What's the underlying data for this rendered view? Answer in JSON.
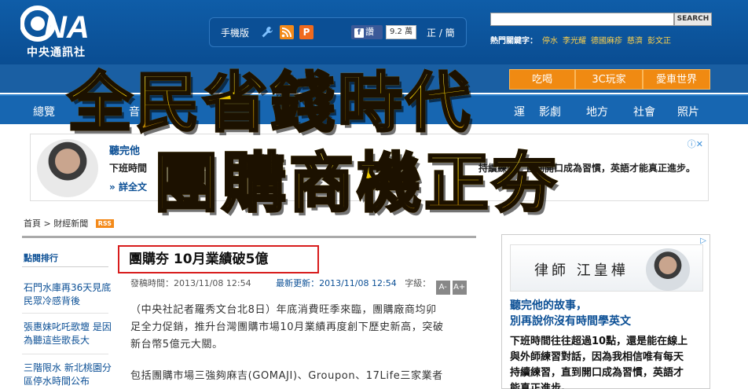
{
  "header": {
    "logo_text": "中央通訊社",
    "mobile_label": "手機版",
    "fb_like_label": "讚",
    "fb_like_count": "9.2 萬",
    "lang_switch": "正 / 簡",
    "search": {
      "button_label": "SEARCH",
      "placeholder": ""
    },
    "hot_keywords_label": "熱門關鍵字：",
    "hot_keywords": [
      "停水",
      "李光耀",
      "德國麻疹",
      "慈濟",
      "彭文正"
    ]
  },
  "channels": [
    "吃喝",
    "3C玩家",
    "愛車世界"
  ],
  "nav": [
    "總覽",
    "",
    "影劇",
    "地方",
    "社會",
    "照片"
  ],
  "nav_partial": {
    "left": "音",
    "right": "運"
  },
  "ad_top": {
    "title": "聽完他",
    "line": "下班時間",
    "line_right": "持續練習，直到開口成為習慣，英語才能真正進步。",
    "more": "詳全文",
    "info_icon": "info-icon"
  },
  "breadcrumb": {
    "home": "首頁",
    "section": "財經新聞",
    "rss": "RSS",
    "separator": ">"
  },
  "ranking": {
    "heading": "點閱排行",
    "items": [
      "石門水庫再36天見底 民眾冷感背後",
      "張惠妹叱吒歌壇 是因為聽這些歌長大",
      "三階限水 新北桃園分區停水時間公布"
    ]
  },
  "article": {
    "headline": "團購夯 10月業績破5億",
    "publish_label": "發稿時間：",
    "publish_time": "2013/11/08 12:54",
    "update_label": "最新更新：",
    "update_time": "2013/11/08 12:54",
    "font_label": "字級：",
    "font_smaller": "A-",
    "font_larger": "A+",
    "paragraphs": [
      "（中央社記者羅秀文台北8日）年底消費旺季來臨，團購廠商均卯",
      "足全力促銷，推升台灣團購市場10月業績再度創下歷史新高，突破",
      "新台幣5億元大關。",
      "包括團購市場三強夠麻吉(GOMAJI)、Groupon、17Life三家業者"
    ]
  },
  "ad_right": {
    "image_text": "律師 江皇樺",
    "title_line1": "聽完他的故事，",
    "title_line2": "別再說你沒有時間學英文",
    "body_line1": "下班時間往往超過10點，還是能在線上",
    "body_line2": "與外師練習對話，因為我相信唯有每天",
    "body_line3": "持續練習，直到開口成為習慣，英語才",
    "body_line4": "能真正進步。"
  },
  "overlay": {
    "line1": "全民省錢時代",
    "line2": "團購商機正夯"
  },
  "colors": {
    "brand_blue": "#0f5da8",
    "accent_orange": "#f08a12",
    "headline_border": "#d81c1c",
    "overlay_gold": "#f3c400"
  }
}
